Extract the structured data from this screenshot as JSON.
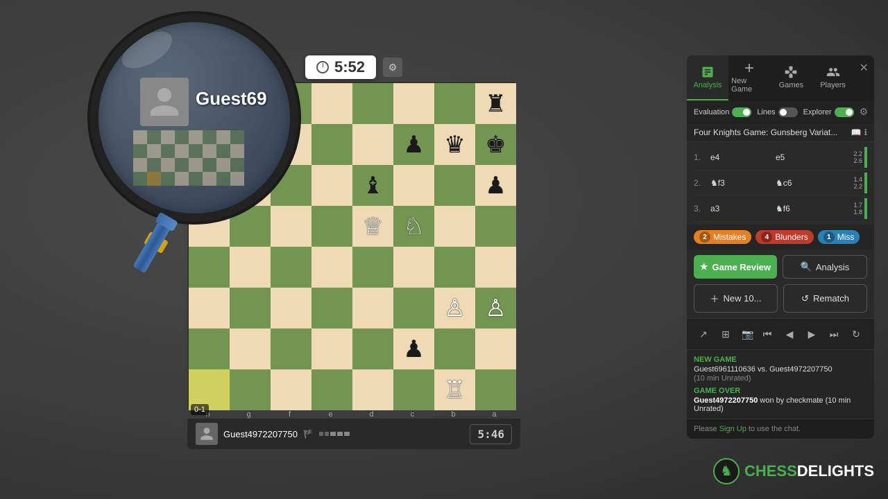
{
  "header": {
    "timer": "5:52",
    "gear_label": "⚙"
  },
  "magnifier": {
    "player_name": "Guest69"
  },
  "board": {
    "score": "0-1",
    "coords_bottom": [
      "h",
      "g",
      "f",
      "e",
      "d",
      "c",
      "b",
      "a"
    ]
  },
  "player_bottom": {
    "name": "Guest4972207750",
    "timer": "5:46",
    "flag": "🏳"
  },
  "panel": {
    "tabs": [
      {
        "id": "analysis",
        "label": "Analysis"
      },
      {
        "id": "new-game",
        "label": "New Game"
      },
      {
        "id": "games",
        "label": "Games"
      },
      {
        "id": "players",
        "label": "Players"
      }
    ],
    "toggles": {
      "evaluation": "Evaluation",
      "lines": "Lines",
      "explorer": "Explorer"
    },
    "opening": "Four Knights Game: Gunsberg Variat...",
    "moves": [
      {
        "num": "1.",
        "white": "e4",
        "black": "e5",
        "score_w": "2.2",
        "score_b": "2.6"
      },
      {
        "num": "2.",
        "white": "♞f3",
        "black": "♞c6",
        "score_w": "1.4",
        "score_b": "2.2"
      },
      {
        "num": "3.",
        "white": "a3",
        "black": "♞f6",
        "score_w": "1.7",
        "score_b": "1.8"
      }
    ],
    "errors": {
      "mistakes": {
        "count": 2,
        "label": "Mistakes"
      },
      "blunders": {
        "count": 4,
        "label": "Blunders"
      },
      "miss": {
        "count": 1,
        "label": "Miss"
      }
    },
    "buttons": {
      "game_review": "Game Review",
      "analysis": "Analysis",
      "new_10": "New 10...",
      "rematch": "Rematch"
    },
    "game_info": {
      "new_game_title": "NEW GAME",
      "players": "Guest6961110636 vs. Guest4972207750",
      "type": "(10 min Unrated)",
      "game_over_title": "GAME OVER",
      "game_over_text": "Guest4972207750 won by checkmate (10 min Unrated)"
    },
    "chat": {
      "text": "Please Sign Up to use the chat.",
      "sign_up": "Sign Up"
    }
  },
  "logo": {
    "chess": "CHESS",
    "delights": "DELIGHTS"
  }
}
